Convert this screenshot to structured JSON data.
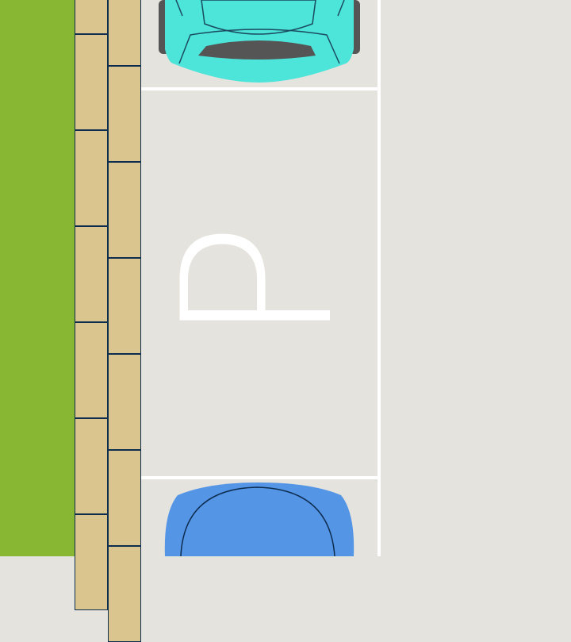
{
  "parking_spot": {
    "label": "P"
  },
  "colors": {
    "grass": "#88b733",
    "sidewalk": "#dac58f",
    "brick_outline": "#0d2d4f",
    "lot": "#e5e3dd",
    "lines": "#ffffff",
    "car_top": "#4de4da",
    "car_bottom": "#5595e6"
  },
  "cars": [
    {
      "name": "teal-car",
      "color": "#4de4da"
    },
    {
      "name": "blue-car",
      "color": "#5595e6"
    }
  ]
}
